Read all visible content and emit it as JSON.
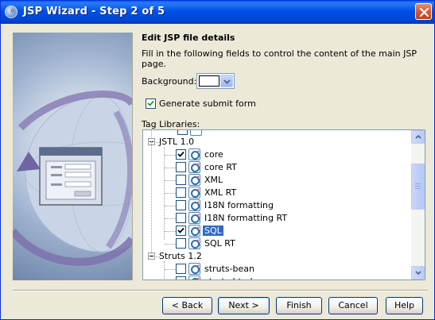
{
  "window": {
    "title": "JSP Wizard - Step 2 of 5",
    "title_icon": "sun-java-icon",
    "close_icon": "close-x-icon"
  },
  "content": {
    "heading": "Edit JSP file details",
    "description": "Fill in the following fields to control the content of the main JSP page.",
    "background_label": "Background:",
    "background_color": "#ffffff",
    "generate_submit_form": {
      "label": "Generate submit form",
      "checked": true
    },
    "tag_libraries_label": "Tag Libraries:"
  },
  "tree": {
    "groups": [
      {
        "name": "JSTL 1.0",
        "expanded": true,
        "items": [
          {
            "label": "core",
            "checked": true,
            "selected": false
          },
          {
            "label": "core RT",
            "checked": false,
            "selected": false
          },
          {
            "label": "XML",
            "checked": false,
            "selected": false
          },
          {
            "label": "XML RT",
            "checked": false,
            "selected": false
          },
          {
            "label": "I18N formatting",
            "checked": false,
            "selected": false
          },
          {
            "label": "I18N formatting RT",
            "checked": false,
            "selected": false
          },
          {
            "label": "SQL",
            "checked": true,
            "selected": true
          },
          {
            "label": "SQL RT",
            "checked": false,
            "selected": false
          }
        ]
      },
      {
        "name": "Struts 1.2",
        "expanded": true,
        "items": [
          {
            "label": "struts-bean",
            "checked": false,
            "selected": false
          },
          {
            "label": "struts-html",
            "checked": false,
            "selected": false
          }
        ]
      }
    ]
  },
  "buttons": {
    "back": "< Back",
    "next": "Next >",
    "finish": "Finish",
    "cancel": "Cancel",
    "help": "Help"
  },
  "colors": {
    "titlebar": "#0050e8",
    "dialog_bg": "#ece9d8",
    "selection": "#316ac5",
    "close_button": "#d7532e"
  }
}
